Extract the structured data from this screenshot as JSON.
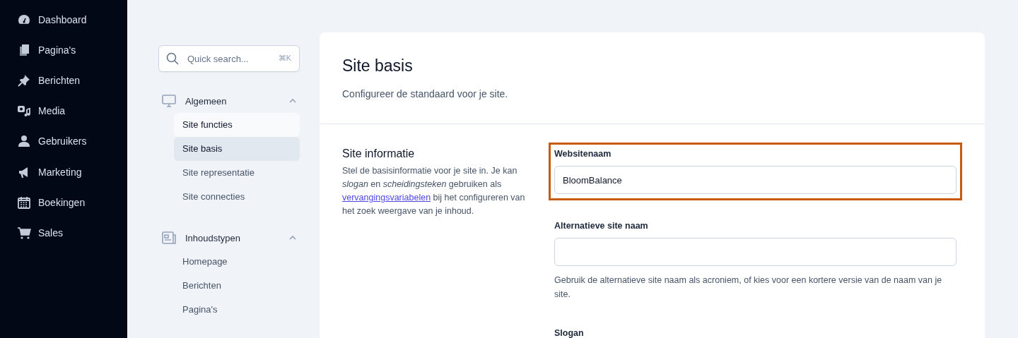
{
  "sidebar": {
    "items": [
      {
        "label": "Dashboard"
      },
      {
        "label": "Pagina's"
      },
      {
        "label": "Berichten"
      },
      {
        "label": "Media"
      },
      {
        "label": "Gebruikers"
      },
      {
        "label": "Marketing"
      },
      {
        "label": "Boekingen"
      },
      {
        "label": "Sales"
      }
    ]
  },
  "settings_nav": {
    "search": {
      "placeholder": "Quick search...",
      "shortcut": "⌘K"
    },
    "groups": [
      {
        "label": "Algemeen",
        "expanded": true,
        "items": [
          {
            "label": "Site functies",
            "selected": false,
            "hovered": true
          },
          {
            "label": "Site basis",
            "selected": true,
            "hovered": false
          },
          {
            "label": "Site representatie",
            "selected": false,
            "hovered": false
          },
          {
            "label": "Site connecties",
            "selected": false,
            "hovered": false
          }
        ]
      },
      {
        "label": "Inhoudstypen",
        "expanded": true,
        "items": [
          {
            "label": "Homepage",
            "selected": false,
            "hovered": false
          },
          {
            "label": "Berichten",
            "selected": false,
            "hovered": false
          },
          {
            "label": "Pagina's",
            "selected": false,
            "hovered": false
          }
        ]
      }
    ]
  },
  "card": {
    "title": "Site basis",
    "subtitle": "Configureer de standaard voor je site.",
    "section": {
      "title": "Site informatie",
      "description_before": "Stel de basisinformatie voor je site in. Je kan *slogan* en *scheidingsteken* gebruiken als",
      "description_link": "vervangingsvariabelen",
      "description_after": "bij het configureren van het zoek weergave van je inhoud."
    },
    "fields": [
      {
        "kind": "text",
        "label": "Websitenaam",
        "value": "BloomBalance",
        "highlighted": true
      },
      {
        "kind": "text",
        "label": "Alternatieve site naam",
        "help": "Gebruik de alternatieve site naam als acroniem, of kies voor een kortere versie van de naam van je site.",
        "highlighted": false
      },
      {
        "kind": "heading",
        "label": "Slogan",
        "highlighted": false
      }
    ]
  }
}
